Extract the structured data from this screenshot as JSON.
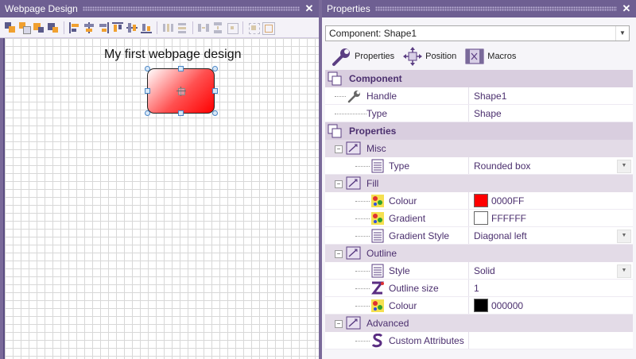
{
  "left_panel": {
    "title": "Webpage Design",
    "close_glyph": "✕",
    "canvas_text": "My first webpage design"
  },
  "right_panel": {
    "title": "Properties",
    "close_glyph": "✕",
    "component_combo": "Component: Shape1",
    "tabs": [
      {
        "label": "Properties",
        "icon": "wrench-icon"
      },
      {
        "label": "Position",
        "icon": "move-arrows-icon"
      },
      {
        "label": "Macros",
        "icon": "macros-icon"
      }
    ],
    "sections": {
      "component": "Component",
      "properties": "Properties",
      "misc": "Misc",
      "fill": "Fill",
      "outline": "Outline",
      "advanced": "Advanced"
    },
    "rows": {
      "handle": {
        "label": "Handle",
        "value": "Shape1"
      },
      "type_comp": {
        "label": "Type",
        "value": "Shape"
      },
      "type_misc": {
        "label": "Type",
        "value": "Rounded box"
      },
      "colour_fill": {
        "label": "Colour",
        "value": "0000FF",
        "swatch": "#ff0000"
      },
      "gradient": {
        "label": "Gradient",
        "value": "FFFFFF",
        "swatch": "#ffffff"
      },
      "gradient_style": {
        "label": "Gradient Style",
        "value": "Diagonal left"
      },
      "style": {
        "label": "Style",
        "value": "Solid"
      },
      "outline_size": {
        "label": "Outline size",
        "value": "1"
      },
      "colour_outline": {
        "label": "Colour",
        "value": "000000",
        "swatch": "#000000"
      },
      "custom_attributes": {
        "label": "Custom Attributes",
        "value": ""
      }
    }
  },
  "colors": {
    "frame": "#7a6a9a",
    "category_bg": "#d9cedf",
    "text_purple": "#4b2f6e"
  }
}
